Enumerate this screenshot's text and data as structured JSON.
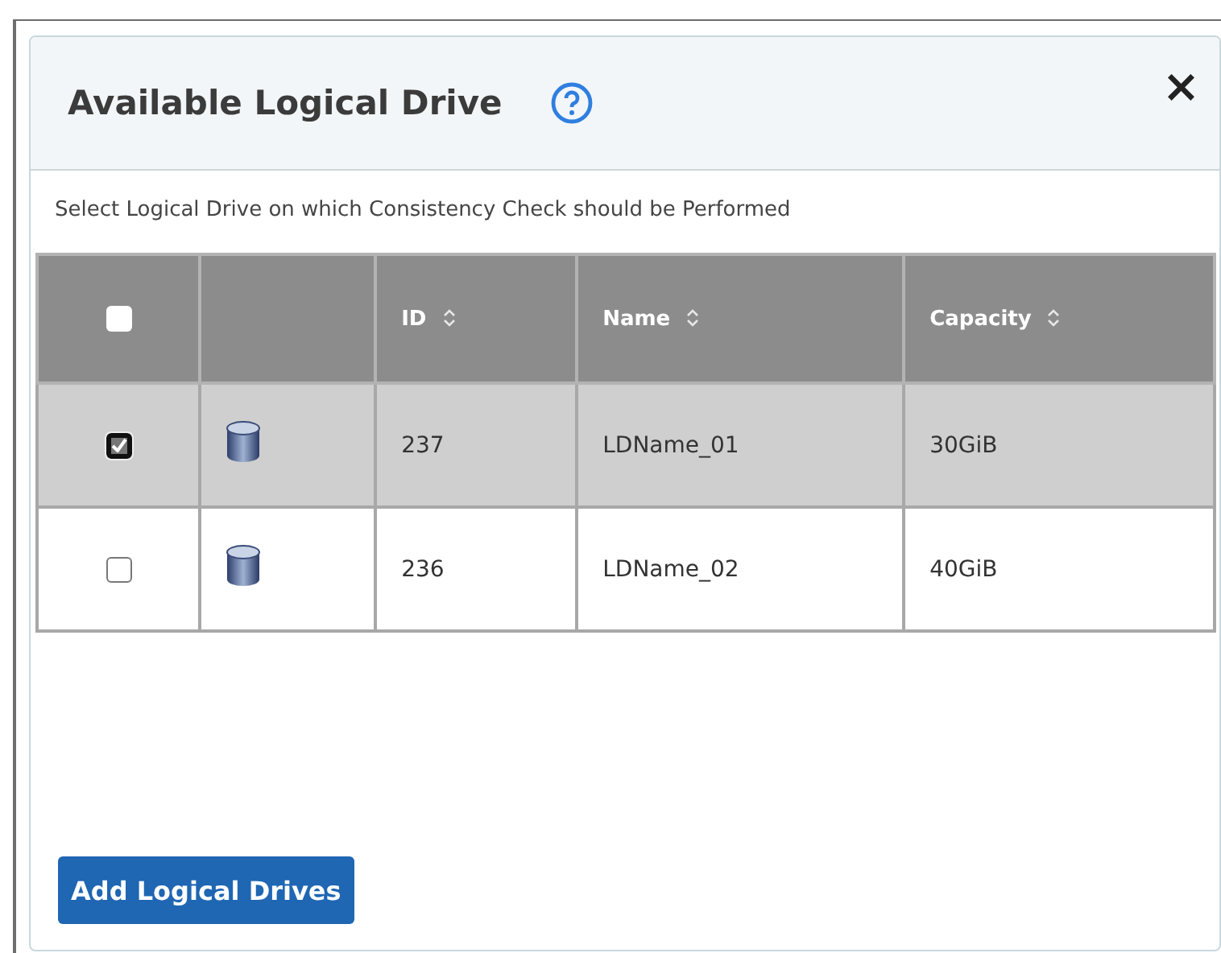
{
  "dialog": {
    "title": "Available Logical Drive",
    "close": "×",
    "subtitle": "Select Logical Drive on which Consistency Check should be Performed"
  },
  "table": {
    "select_all": {
      "checked": false
    },
    "columns": [
      {
        "label": "ID",
        "sortable": true
      },
      {
        "label": "Name",
        "sortable": true
      },
      {
        "label": "Capacity",
        "sortable": true
      }
    ],
    "rows": [
      {
        "selected": true,
        "checked": true,
        "id": "237",
        "name": "LDName_01",
        "capacity": "30GiB"
      },
      {
        "selected": false,
        "checked": false,
        "id": "236",
        "name": "LDName_02",
        "capacity": "40GiB"
      }
    ]
  },
  "button": "Add Logical Drives"
}
